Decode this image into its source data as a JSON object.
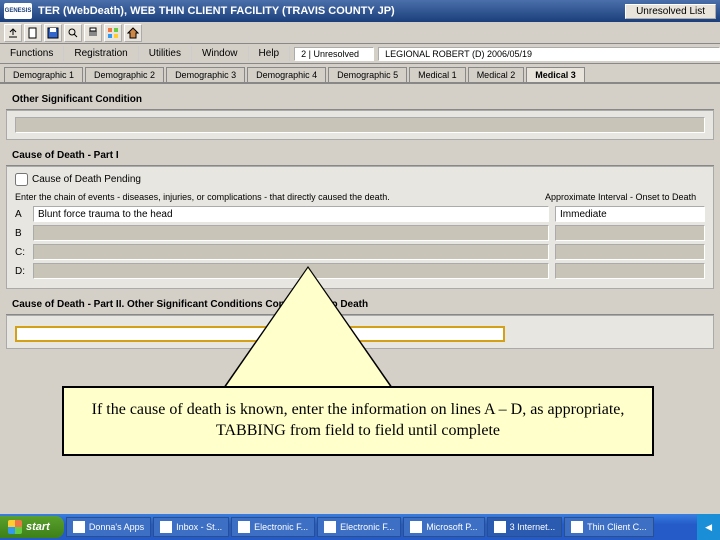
{
  "titlebar": {
    "logo": "GENESIS",
    "title": "TER (WebDeath), WEB THIN CLIENT FACILITY (TRAVIS COUNTY JP)",
    "unresolved_btn": "Unresolved List"
  },
  "menubar": {
    "items": [
      "Functions",
      "Registration",
      "Utilities",
      "Window",
      "Help"
    ],
    "status": "2 | Unresolved",
    "recent": "LEGIONAL ROBERT (D) 2006/05/19"
  },
  "tabs": [
    "Demographic 1",
    "Demographic 2",
    "Demographic 3",
    "Demographic 4",
    "Demographic 5",
    "Medical 1",
    "Medical 2",
    "Medical 3"
  ],
  "active_tab": 7,
  "sections": {
    "osc": {
      "title": "Other Significant Condition"
    },
    "part1": {
      "title": "Cause of Death - Part I",
      "pending_label": "Cause of Death Pending",
      "instructions": "Enter the chain of events - diseases, injuries, or complications - that directly caused the death.",
      "interval_header": "Approximate Interval - Onset to Death",
      "lines": {
        "A": {
          "value": "Blunt force trauma to the head",
          "interval": "Immediate"
        },
        "B": {
          "value": "",
          "interval": ""
        },
        "C": {
          "value": "",
          "interval": ""
        },
        "D": {
          "value": "",
          "interval": ""
        }
      }
    },
    "part2": {
      "title": "Cause of Death - Part II. Other Significant Conditions Contributing to Death"
    }
  },
  "annotation": "If the cause of death is known, enter the information on lines A – D, as appropriate, TABBING from field to field until complete",
  "taskbar": {
    "start": "start",
    "items": [
      "Donna's Apps",
      "Inbox - St...",
      "Electronic F...",
      "Electronic F...",
      "Microsoft P...",
      "3 Internet...",
      "Thin Client C..."
    ],
    "active_item": 5
  }
}
